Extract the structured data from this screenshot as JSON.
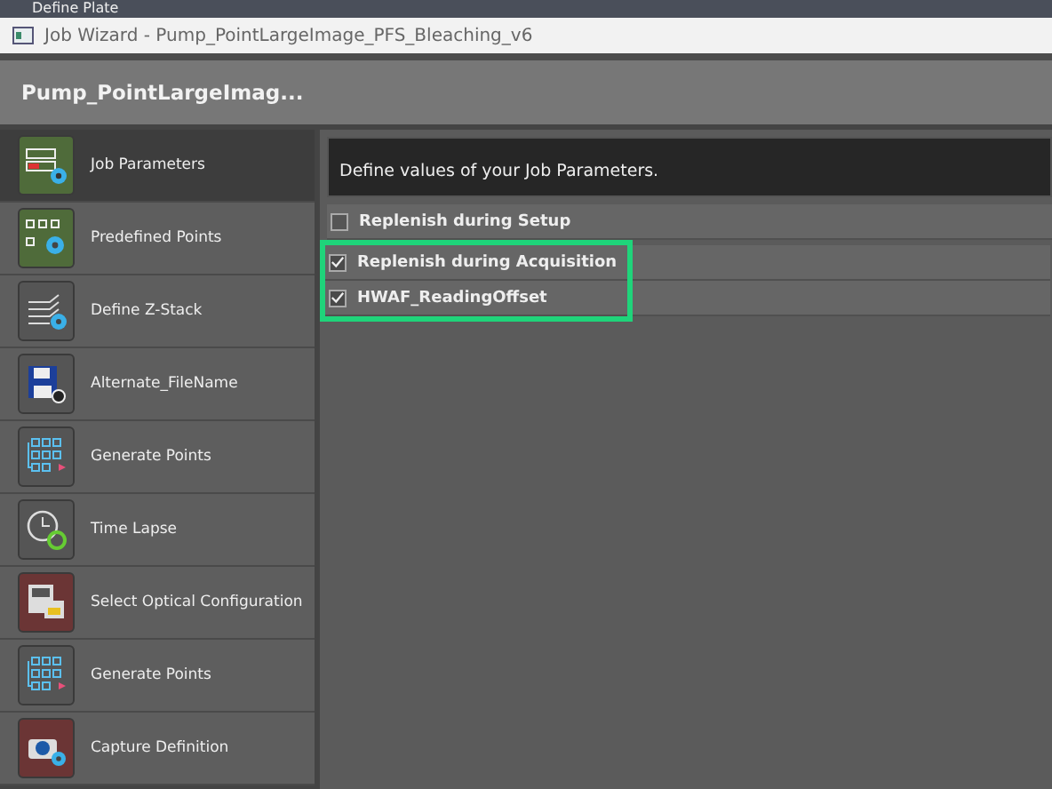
{
  "background_app": {
    "text": "Define Plate"
  },
  "window": {
    "title": "Job Wizard - Pump_PointLargeImage_PFS_Bleaching_v6"
  },
  "header": {
    "title": "Pump_PointLargeImag..."
  },
  "sidebar": {
    "items": [
      {
        "label": "Job Parameters",
        "kind": "parameters",
        "color": "#4f6b3a",
        "selected": true
      },
      {
        "label": "Predefined Points",
        "kind": "points",
        "color": "#4f6b3a",
        "selected": false
      },
      {
        "label": "Define Z-Stack",
        "kind": "zstack",
        "color": "#555555",
        "selected": false
      },
      {
        "label": "Alternate_FileName",
        "kind": "save",
        "color": "#555555",
        "selected": false
      },
      {
        "label": "Generate Points",
        "kind": "generate",
        "color": "#555555",
        "selected": false
      },
      {
        "label": "Time Lapse",
        "kind": "clock",
        "color": "#555555",
        "selected": false
      },
      {
        "label": "Select Optical Configuration",
        "kind": "optical",
        "color": "#6b3535",
        "selected": false
      },
      {
        "label": "Generate Points",
        "kind": "generate",
        "color": "#555555",
        "selected": false
      },
      {
        "label": "Capture Definition",
        "kind": "camera",
        "color": "#6b3535",
        "selected": false
      }
    ]
  },
  "description": "Define values of your Job Parameters.",
  "options": [
    {
      "label": "Replenish during Setup",
      "checked": false,
      "highlighted": false
    },
    {
      "label": "Replenish during Acquisition",
      "checked": true,
      "highlighted": true
    },
    {
      "label": "HWAF_ReadingOffset",
      "checked": true,
      "highlighted": true
    }
  ]
}
